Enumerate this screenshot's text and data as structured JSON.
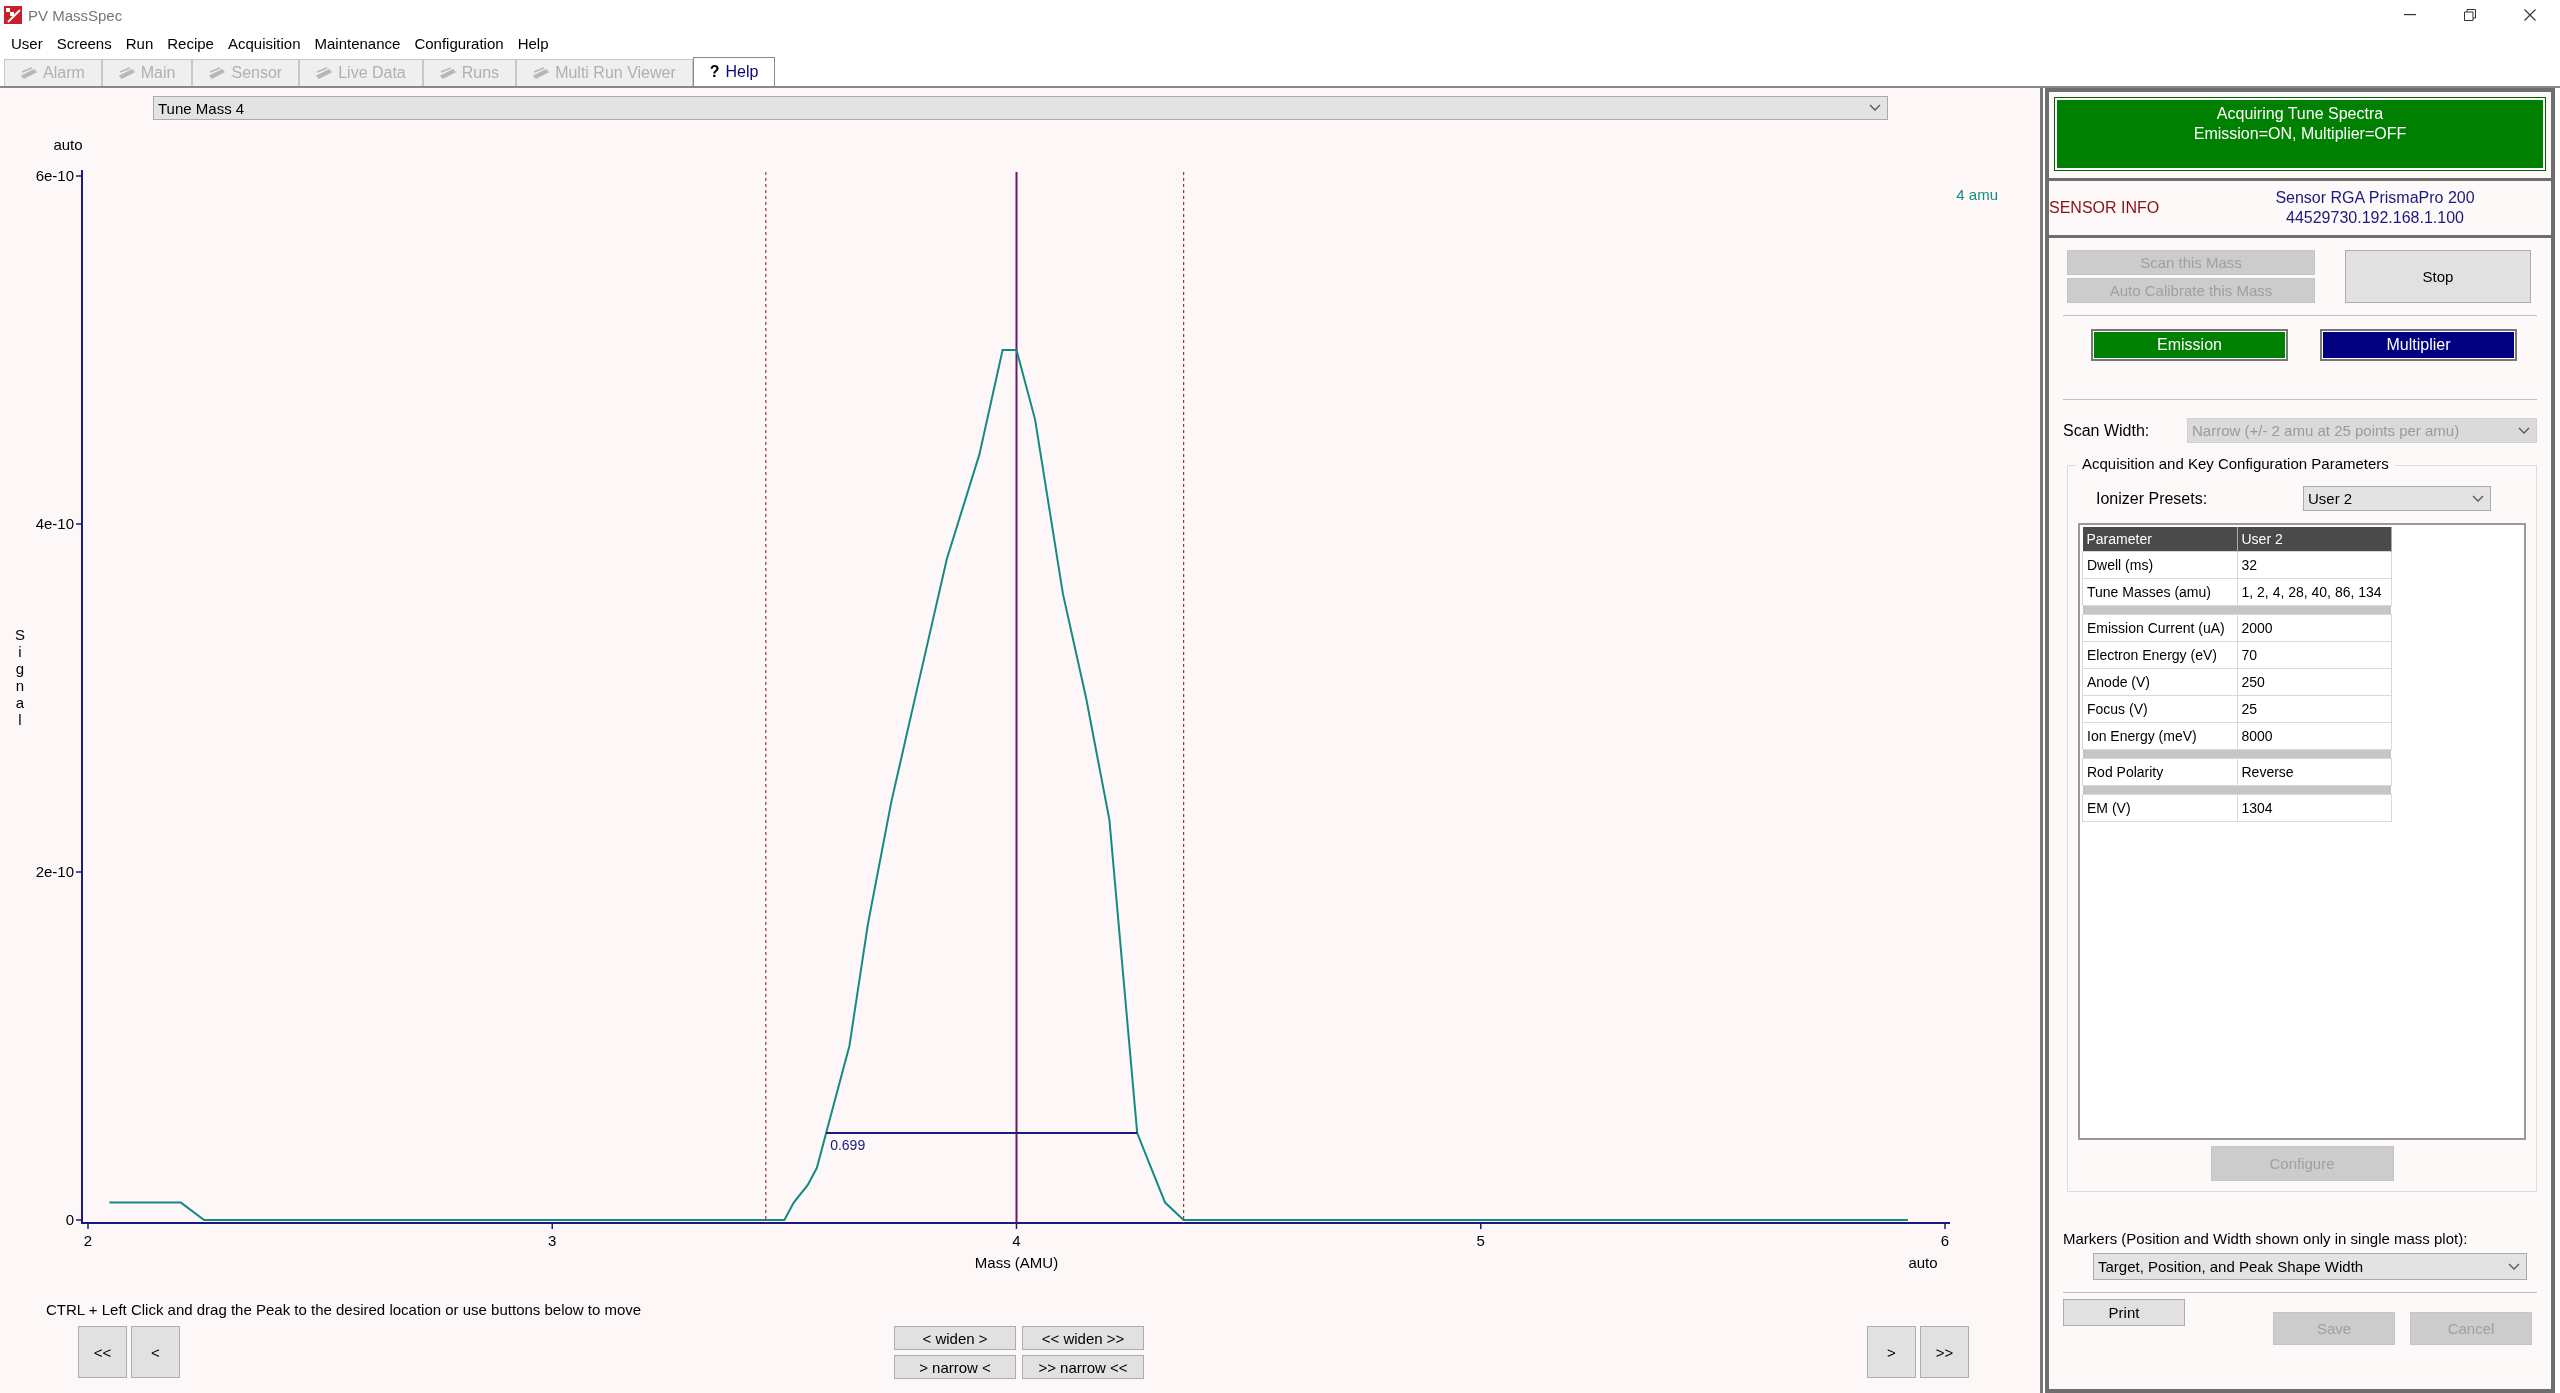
{
  "window": {
    "title": "PV MassSpec"
  },
  "menu": [
    "User",
    "Screens",
    "Run",
    "Recipe",
    "Acquisition",
    "Maintenance",
    "Configuration",
    "Help"
  ],
  "tabs": [
    {
      "label": "Alarm",
      "kind": "screen",
      "selected": false,
      "disabled": true
    },
    {
      "label": "Main",
      "kind": "screen",
      "selected": false,
      "disabled": true
    },
    {
      "label": "Sensor",
      "kind": "screen",
      "selected": false,
      "disabled": true
    },
    {
      "label": "Live Data",
      "kind": "screen",
      "selected": false,
      "disabled": true
    },
    {
      "label": "Runs",
      "kind": "screen",
      "selected": false,
      "disabled": true
    },
    {
      "label": "Multi Run Viewer",
      "kind": "screen",
      "selected": false,
      "disabled": true
    },
    {
      "label": "Help",
      "kind": "help",
      "mark": "?",
      "selected": true,
      "disabled": false
    }
  ],
  "tune_select": {
    "value": "Tune Mass 4"
  },
  "chart": {
    "y_scale": "auto",
    "x_scale": "auto",
    "chart_data": {
      "type": "line",
      "xlabel": "Mass (AMU)",
      "ylabel": "Signal",
      "x": [
        2.046,
        2.12,
        2.2,
        2.25,
        2.3,
        2.37,
        2.5,
        2.75,
        3.0,
        3.25,
        3.4,
        3.46,
        3.5,
        3.52,
        3.55,
        3.57,
        3.6,
        3.64,
        3.68,
        3.73,
        3.79,
        3.85,
        3.92,
        3.97,
        4.0,
        4.04,
        4.1,
        4.15,
        4.2,
        4.23,
        4.26,
        4.29,
        4.32,
        4.36,
        4.42,
        4.5,
        5.0,
        5.5,
        5.92
      ],
      "series": [
        {
          "color": "#148a82",
          "values": [
            1e-11,
            1e-11,
            1e-11,
            0,
            0,
            0,
            0,
            0,
            0,
            0,
            0,
            0,
            0,
            1e-11,
            2e-11,
            3e-11,
            6e-11,
            1e-10,
            1.7e-10,
            2.4e-10,
            3.1e-10,
            3.8e-10,
            4.4e-10,
            5e-10,
            5e-10,
            4.6e-10,
            3.6e-10,
            3e-10,
            2.3e-10,
            1.4e-10,
            5e-11,
            3e-11,
            1e-11,
            0,
            0,
            0,
            0,
            0,
            0
          ]
        }
      ],
      "xlim": [
        2,
        6
      ],
      "ylim": [
        0,
        6e-10
      ],
      "xticks": [
        2,
        3,
        4,
        5,
        6
      ],
      "yticks": [
        {
          "value": 0,
          "label": "0"
        },
        {
          "value": 2e-10,
          "label": "2e-10"
        },
        {
          "value": 4e-10,
          "label": "4e-10"
        },
        {
          "value": 6e-10,
          "label": "6e-10"
        }
      ],
      "ref_lines": [
        {
          "axis": "x",
          "value": 4,
          "color": "#6a1a6a"
        },
        {
          "axis": "x",
          "value": 3.46,
          "color": "#a03040"
        },
        {
          "axis": "x",
          "value": 4.36,
          "color": "#a03040"
        }
      ],
      "annotations": [
        "0.699"
      ]
    },
    "mass_label": "4 amu"
  },
  "instruction": "CTRL + Left Click and drag the Peak to the desired location or use buttons below to move",
  "nav": {
    "left": [
      "<<",
      "<"
    ],
    "widen": [
      "< widen >",
      "<< widen >>"
    ],
    "narrow": [
      "> narrow <",
      ">> narrow <<"
    ],
    "right": [
      ">",
      ">>"
    ]
  },
  "status": {
    "lines": [
      "Acquiring Tune Spectra",
      "Emission=ON, Multiplier=OFF"
    ]
  },
  "sensor_info": {
    "label": "SENSOR INFO",
    "lines": [
      "Sensor RGA PrismaPro 200",
      "44529730.192.168.1.100"
    ]
  },
  "scan_actions": [
    {
      "label": "Scan this Mass",
      "disabled": true
    },
    {
      "label": "Auto Calibrate this Mass",
      "disabled": true
    }
  ],
  "stop_button": {
    "label": "Stop"
  },
  "toggles": [
    {
      "label": "Emission",
      "color": "#008000"
    },
    {
      "label": "Multiplier",
      "color": "#000080"
    }
  ],
  "scan_width": {
    "label": "Scan Width:",
    "value": "Narrow (+/- 2 amu at 25 points per amu)",
    "disabled": true
  },
  "params": {
    "title": "Acquisition and Key Configuration Parameters",
    "preset_label": "Ionizer Presets:",
    "preset_value": "User 2",
    "table": {
      "columns": [
        "Parameter",
        "User 2"
      ],
      "rows": [
        {
          "kind": "param",
          "cells": [
            "Dwell (ms)",
            "32"
          ]
        },
        {
          "kind": "param",
          "cells": [
            "Tune Masses (amu)",
            "1, 2, 4, 28, 40, 86, 134"
          ]
        },
        {
          "kind": "separator"
        },
        {
          "kind": "param",
          "cells": [
            "Emission Current (uA)",
            "2000"
          ]
        },
        {
          "kind": "param",
          "cells": [
            "Electron Energy (eV)",
            "70"
          ]
        },
        {
          "kind": "param",
          "cells": [
            "Anode (V)",
            "250"
          ]
        },
        {
          "kind": "param",
          "cells": [
            "Focus (V)",
            "25"
          ]
        },
        {
          "kind": "param",
          "cells": [
            "Ion Energy (meV)",
            "8000"
          ]
        },
        {
          "kind": "separator"
        },
        {
          "kind": "param",
          "cells": [
            "Rod Polarity",
            "Reverse"
          ]
        },
        {
          "kind": "separator"
        },
        {
          "kind": "param",
          "cells": [
            "EM (V)",
            "1304"
          ]
        }
      ]
    },
    "configure": {
      "label": "Configure",
      "disabled": true
    }
  },
  "markers": {
    "label": "Markers (Position and Width shown only in single mass plot):",
    "value": "Target, Position, and Peak Shape Width"
  },
  "footer_buttons": [
    {
      "label": "Print",
      "disabled": false
    },
    {
      "label": "Save",
      "disabled": true
    },
    {
      "label": "Cancel",
      "disabled": true
    }
  ]
}
